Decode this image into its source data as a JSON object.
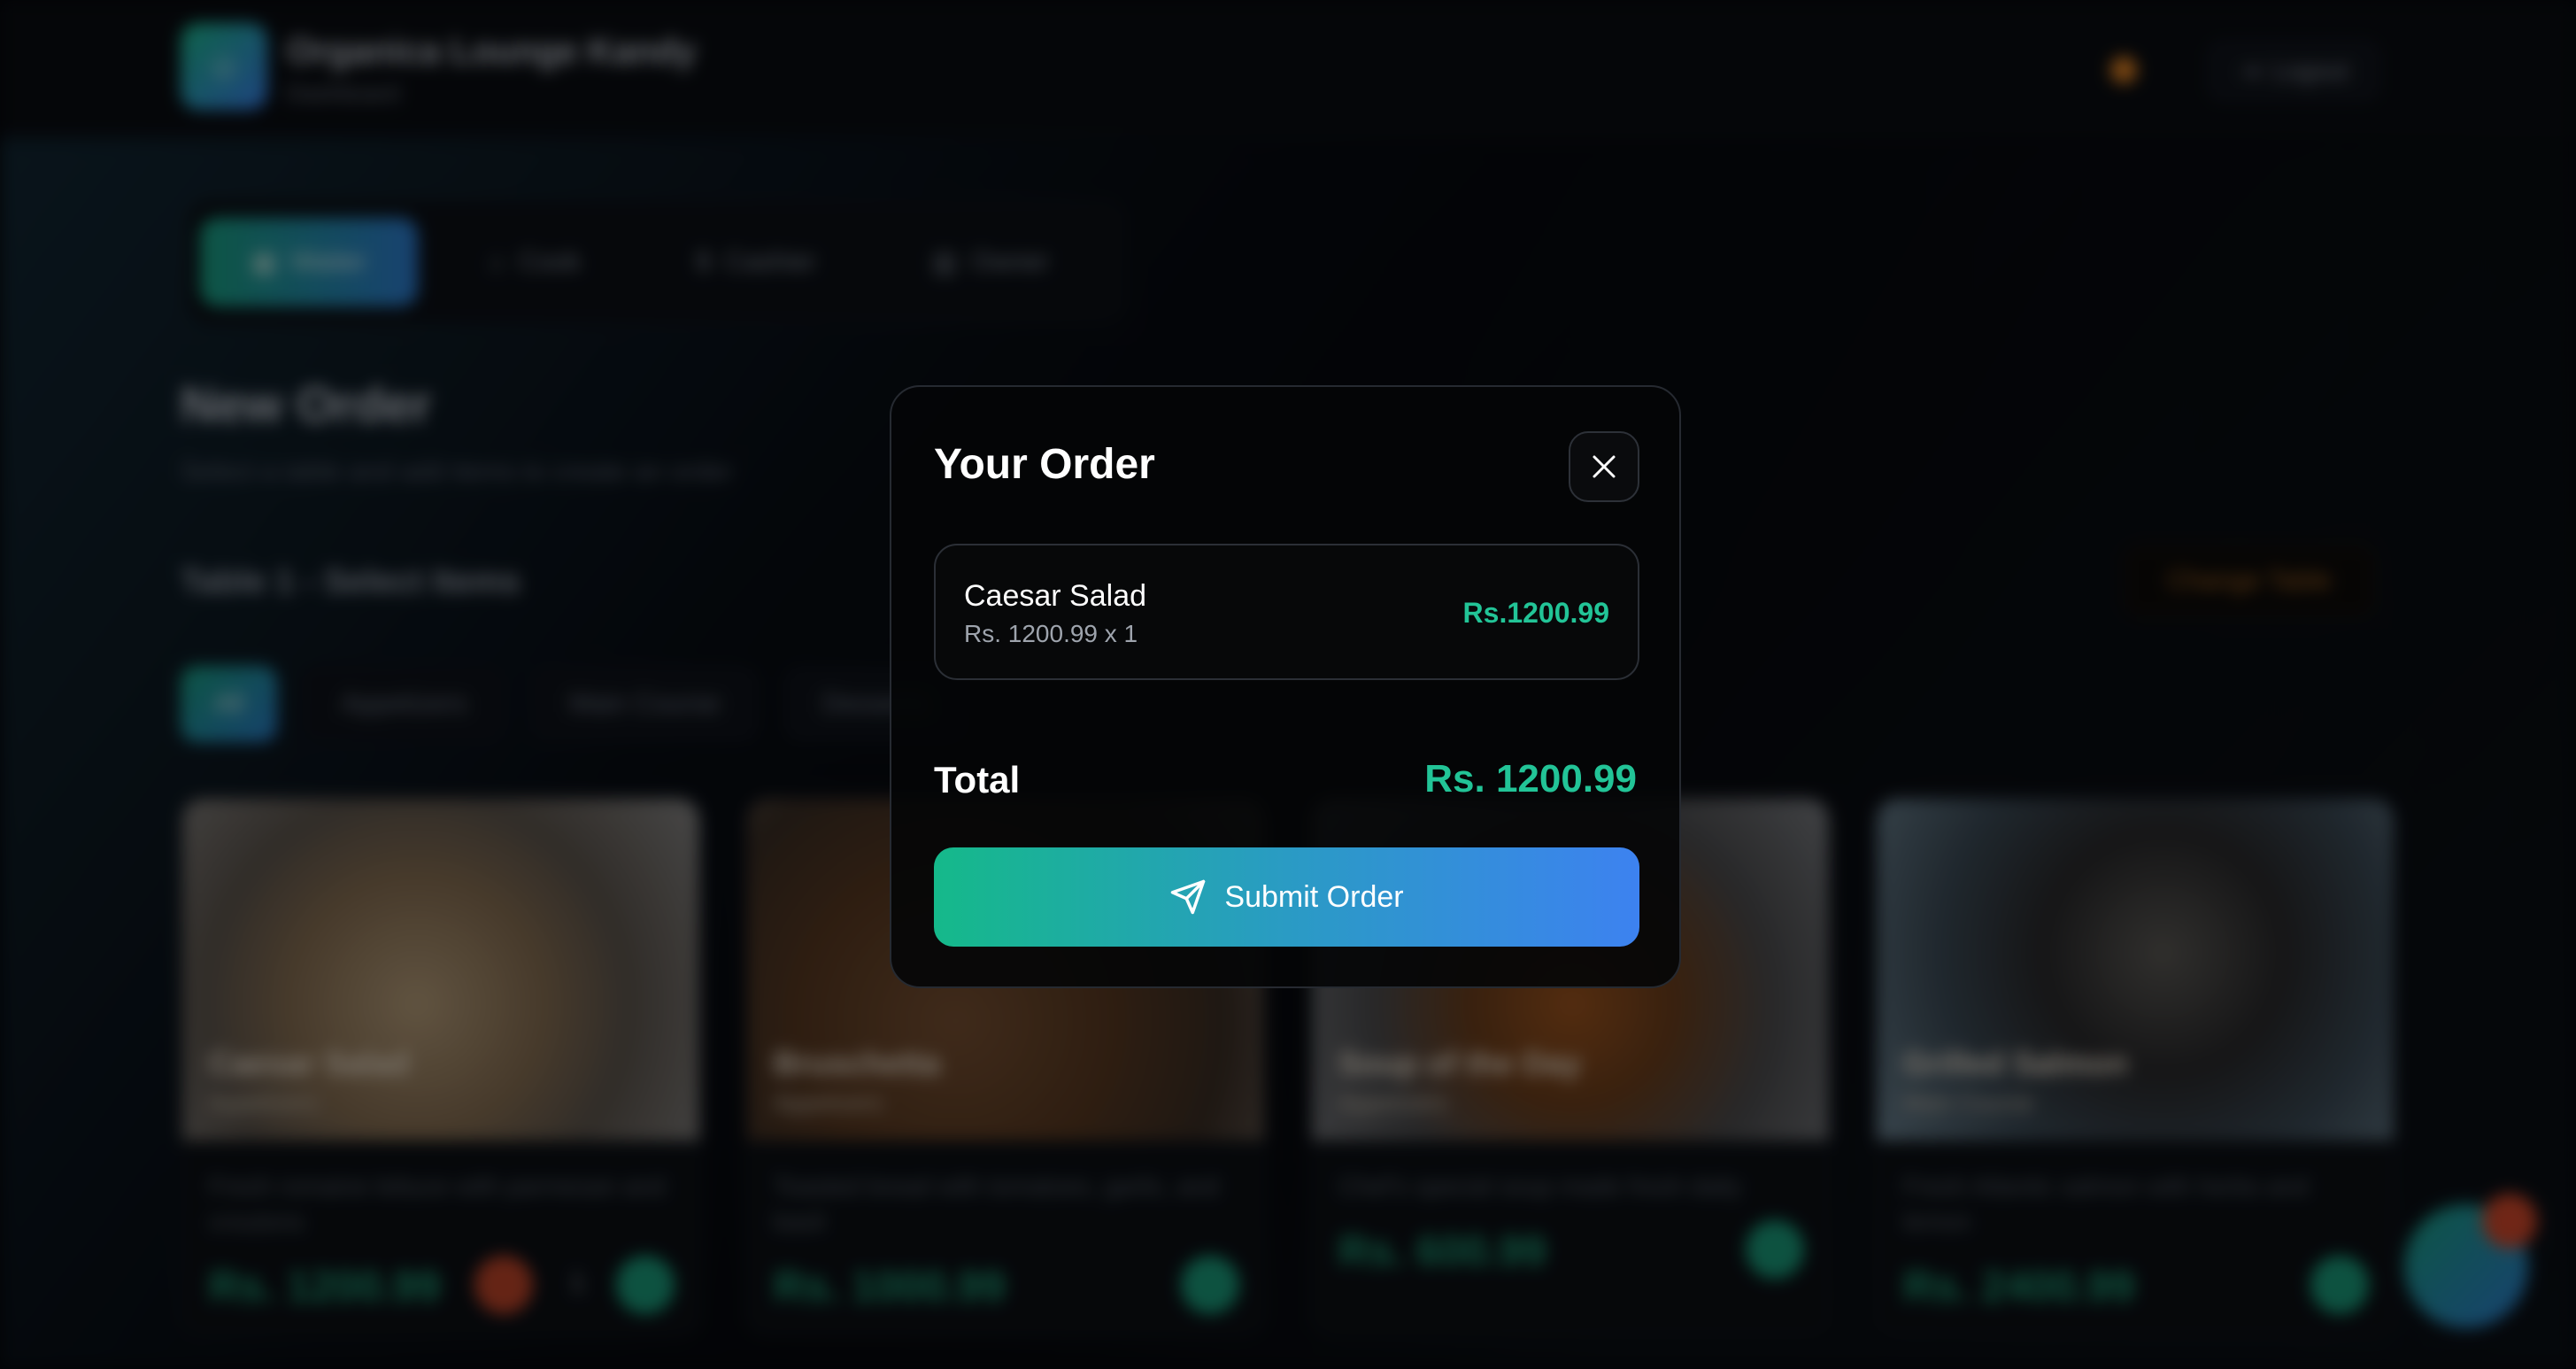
{
  "background": {
    "brand": {
      "title": "Organica Lounge Kandy",
      "subtitle": "Dashboard"
    },
    "logout_label": "Logout",
    "role_tabs": [
      {
        "label": "Waiter",
        "icon": "waiter-icon"
      },
      {
        "label": "Cook",
        "icon": "chef-hat-icon"
      },
      {
        "label": "Cashier",
        "icon": "dollar-icon"
      },
      {
        "label": "Owner",
        "icon": "chart-icon"
      }
    ],
    "page_title": "New Order",
    "page_subtitle": "Select a table and add items to create an order",
    "section_title": "Table 1 - Select Items",
    "change_table_label": "Change Table",
    "categories": [
      {
        "label": "All"
      },
      {
        "label": "Appetizers"
      },
      {
        "label": "Main Course"
      },
      {
        "label": "Desserts"
      }
    ],
    "menu_cards": [
      {
        "name": "Caesar Salad",
        "category": "Appetizers",
        "description": "Fresh romaine lettuce with parmesan and croutons",
        "price": "Rs. 1200.99",
        "quantity": "1"
      },
      {
        "name": "Bruschetta",
        "category": "Appetizers",
        "description": "Toasted bread with tomatoes, garlic, and basil",
        "price": "Rs. 1000.99"
      },
      {
        "name": "Soup of the Day",
        "category": "Appetizers",
        "description": "Chef's special soup made fresh daily",
        "price": "Rs. 600.99"
      },
      {
        "name": "Grilled Salmon",
        "category": "Main Course",
        "description": "Fresh Atlantic salmon with herbs and lemon",
        "price": "Rs. 2400.99"
      }
    ]
  },
  "modal": {
    "title": "Your Order",
    "close_icon": "close-icon",
    "items": [
      {
        "name": "Caesar Salad",
        "unit_line": "Rs. 1200.99 x 1",
        "line_total": "Rs.1200.99"
      }
    ],
    "total_label": "Total",
    "total_value": "Rs. 1200.99",
    "submit_label": "Submit Order",
    "submit_icon": "send-icon"
  },
  "colors": {
    "accent_green": "#22c497",
    "accent_blue": "#3d82f0",
    "modal_bg": "#040507",
    "danger": "#d64a2c"
  }
}
